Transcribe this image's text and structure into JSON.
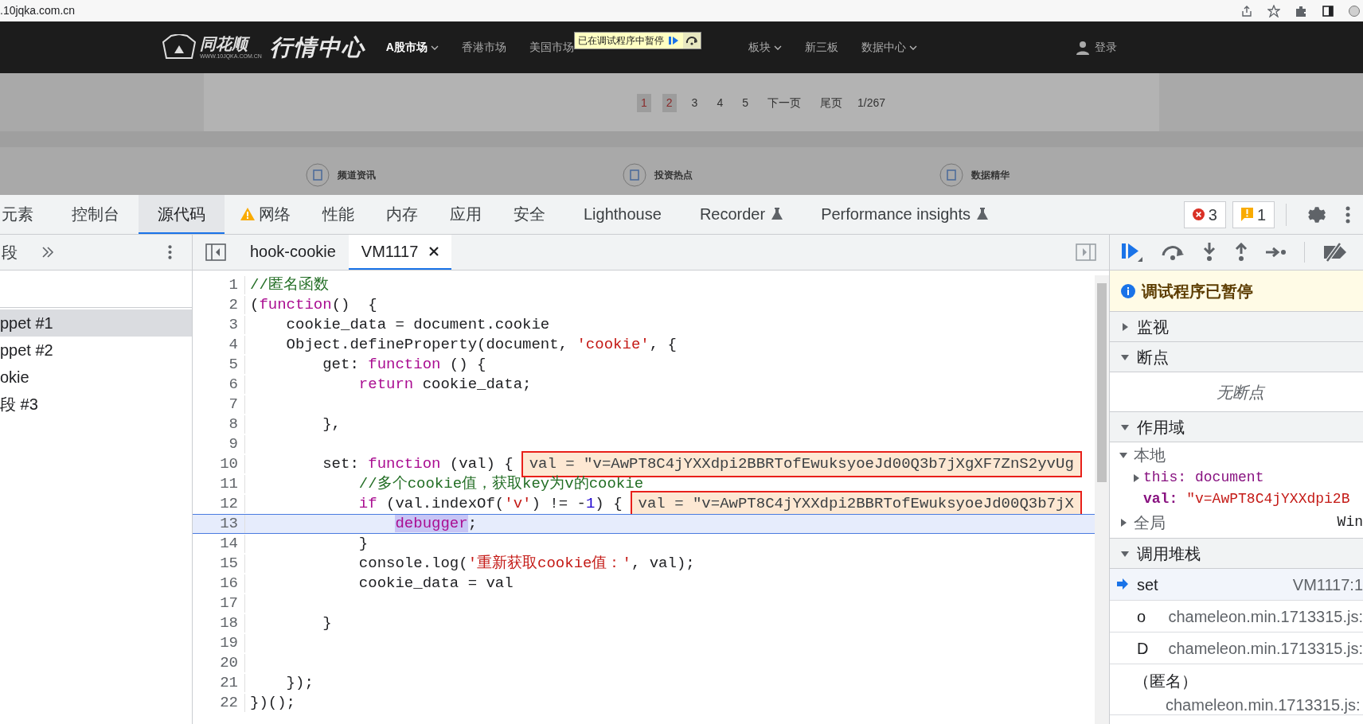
{
  "browser": {
    "url": ".10jqka.com.cn"
  },
  "site_header": {
    "logo_text": "同花顺",
    "logo_subtext": "WWW.10JQKA.COM.CN",
    "title": "行情中心",
    "nav": [
      {
        "label": "A股市场",
        "dropdown": true,
        "selected": true
      },
      {
        "label": "香港市场",
        "dropdown": false,
        "selected": false
      },
      {
        "label": "美国市场",
        "dropdown": false,
        "selected": false
      },
      {
        "label": "板块",
        "dropdown": true,
        "selected": false
      },
      {
        "label": "新三板",
        "dropdown": false,
        "selected": false
      },
      {
        "label": "数据中心",
        "dropdown": true,
        "selected": false
      }
    ],
    "login": "登录"
  },
  "paused_overlay": {
    "label": "已在调试程序中暂停"
  },
  "pagination": [
    {
      "label": "1",
      "selected": true
    },
    {
      "label": "2",
      "selected": true
    },
    {
      "label": "3",
      "selected": false
    },
    {
      "label": "4",
      "selected": false
    },
    {
      "label": "5",
      "selected": false
    },
    {
      "label": "下一页",
      "selected": false
    },
    {
      "label": "尾页",
      "selected": false
    }
  ],
  "page_count": "1/267",
  "channels": [
    "频道资讯",
    "投资热点",
    "数据精华"
  ],
  "devtools": {
    "tabs": [
      {
        "label": "元素",
        "selected": false,
        "kind": "plain"
      },
      {
        "label": "控制台",
        "selected": false,
        "kind": "plain"
      },
      {
        "label": "源代码",
        "selected": true,
        "kind": "plain"
      },
      {
        "label": "网络",
        "selected": false,
        "kind": "warning"
      },
      {
        "label": "性能",
        "selected": false,
        "kind": "plain"
      },
      {
        "label": "内存",
        "selected": false,
        "kind": "plain"
      },
      {
        "label": "应用",
        "selected": false,
        "kind": "plain"
      },
      {
        "label": "安全",
        "selected": false,
        "kind": "plain"
      },
      {
        "label": "Lighthouse",
        "selected": false,
        "kind": "plain"
      },
      {
        "label": "Recorder",
        "selected": false,
        "kind": "experimental"
      },
      {
        "label": "Performance insights",
        "selected": false,
        "kind": "experimental"
      }
    ],
    "error_count": "3",
    "warning_count": "1",
    "navigator_tab": "段",
    "snippets": [
      {
        "label": "ppet #1",
        "selected": true
      },
      {
        "label": "ppet #2",
        "selected": false
      },
      {
        "label": "okie",
        "selected": false
      },
      {
        "label": "段 #3",
        "selected": false
      }
    ],
    "file_tabs": [
      {
        "label": "hook-cookie",
        "selected": false,
        "closable": false
      },
      {
        "label": "VM1117",
        "selected": true,
        "closable": true
      }
    ],
    "code": [
      {
        "number": "1",
        "current": false,
        "tokens": [
          {
            "text": "//匿名函数",
            "kind": "comment"
          }
        ]
      },
      {
        "number": "2",
        "current": false,
        "tokens": [
          {
            "text": "(",
            "kind": "plain"
          },
          {
            "text": "function",
            "kind": "keyword"
          },
          {
            "text": "()  {",
            "kind": "plain"
          }
        ]
      },
      {
        "number": "3",
        "current": false,
        "tokens": [
          {
            "text": "    cookie_data = document.cookie",
            "kind": "plain"
          }
        ]
      },
      {
        "number": "4",
        "current": false,
        "tokens": [
          {
            "text": "    Object.defineProperty(document, ",
            "kind": "plain"
          },
          {
            "text": "'cookie'",
            "kind": "string"
          },
          {
            "text": ", {",
            "kind": "plain"
          }
        ]
      },
      {
        "number": "5",
        "current": false,
        "tokens": [
          {
            "text": "        get: ",
            "kind": "plain"
          },
          {
            "text": "function",
            "kind": "keyword"
          },
          {
            "text": " () {",
            "kind": "plain"
          }
        ]
      },
      {
        "number": "6",
        "current": false,
        "tokens": [
          {
            "text": "            return",
            "kind": "keyword"
          },
          {
            "text": " cookie_data;",
            "kind": "plain"
          }
        ]
      },
      {
        "number": "7",
        "current": false
      },
      {
        "number": "8",
        "current": false,
        "tokens": [
          {
            "text": "        },",
            "kind": "plain"
          }
        ]
      },
      {
        "number": "9",
        "current": false
      },
      {
        "number": "10",
        "current": false,
        "tokens": [
          {
            "text": "        set: ",
            "kind": "plain"
          },
          {
            "text": "function",
            "kind": "keyword"
          },
          {
            "text": " (val) {",
            "kind": "plain"
          }
        ],
        "inline_value": {
          "text": "val = \"v=AwPT8C4jYXXdpi2BBRTofEwuksyoeJd00Q3b7jXgXF7ZnS2yvUg",
          "framed": true
        }
      },
      {
        "number": "11",
        "current": false,
        "tokens": [
          {
            "text": "            //多个cookie值，获取key为v的cookie",
            "kind": "comment"
          }
        ]
      },
      {
        "number": "12",
        "current": false,
        "tokens": [
          {
            "text": "            if",
            "kind": "keyword"
          },
          {
            "text": " (val.indexOf(",
            "kind": "plain"
          },
          {
            "text": "'v'",
            "kind": "string"
          },
          {
            "text": ") != -",
            "kind": "plain"
          },
          {
            "text": "1",
            "kind": "number"
          },
          {
            "text": ") {",
            "kind": "plain"
          }
        ],
        "inline_value": {
          "text": "val = \"v=AwPT8C4jYXXdpi2BBRTofEwuksyoeJd00Q3b7jX",
          "framed": true
        }
      },
      {
        "number": "13",
        "current": true,
        "tokens": [
          {
            "text": "                debugger",
            "kind": "paused"
          },
          {
            "text": ";",
            "kind": "plain"
          }
        ]
      },
      {
        "number": "14",
        "current": false,
        "tokens": [
          {
            "text": "            }",
            "kind": "plain"
          }
        ]
      },
      {
        "number": "15",
        "current": false,
        "tokens": [
          {
            "text": "            console.log(",
            "kind": "plain"
          },
          {
            "text": "'重新获取cookie值：'",
            "kind": "string"
          },
          {
            "text": ", val);",
            "kind": "plain"
          }
        ]
      },
      {
        "number": "16",
        "current": false,
        "tokens": [
          {
            "text": "            cookie_data = val",
            "kind": "plain"
          }
        ]
      },
      {
        "number": "17",
        "current": false
      },
      {
        "number": "18",
        "current": false,
        "tokens": [
          {
            "text": "        }",
            "kind": "plain"
          }
        ]
      },
      {
        "number": "19",
        "current": false
      },
      {
        "number": "20",
        "current": false
      },
      {
        "number": "21",
        "current": false,
        "tokens": [
          {
            "text": "    });",
            "kind": "plain"
          }
        ]
      },
      {
        "number": "22",
        "current": false,
        "tokens": [
          {
            "text": "})();",
            "kind": "plain"
          }
        ]
      }
    ],
    "paused_banner": "调试程序已暂停",
    "watch": {
      "label": "监视",
      "expanded": false
    },
    "breakpoints": {
      "label": "断点",
      "expanded": true,
      "empty_text": "无断点"
    },
    "scope": {
      "label": "作用域",
      "expanded": true,
      "groups": [
        {
          "label": "本地",
          "expanded": true,
          "children": [
            {
              "name": "this:",
              "value": "document",
              "kind": "object",
              "expanded": false
            },
            {
              "name": "val:",
              "value": "\"v=AwPT8C4jYXXdpi2B",
              "kind": "string"
            }
          ]
        },
        {
          "label": "全局",
          "expanded": false,
          "value": "Win"
        }
      ]
    },
    "call_stack": {
      "label": "调用堆栈",
      "expanded": true,
      "frames": [
        {
          "name": "set",
          "location": "VM1117:1",
          "current": true
        },
        {
          "name": "o",
          "location": "chameleon.min.1713315.js:",
          "current": false
        },
        {
          "name": "D",
          "location": "chameleon.min.1713315.js:",
          "current": false
        },
        {
          "name": "（匿名）",
          "location": "chameleon.min.1713315.js:",
          "current": false
        }
      ]
    }
  }
}
